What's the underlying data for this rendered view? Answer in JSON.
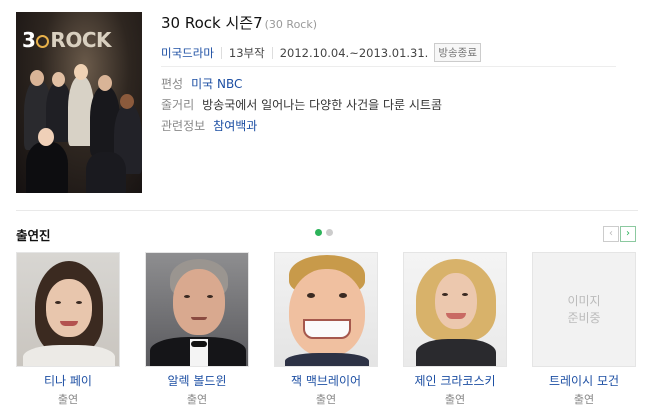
{
  "show": {
    "title": "30 Rock 시즌7",
    "original_title": "(30 Rock)",
    "poster_logo": "30ROCK",
    "genre": "미국드라마",
    "episodes": "13부작",
    "airdates": "2012.10.04.~2013.01.31.",
    "status_badge": "방송종료"
  },
  "info": [
    {
      "label": "편성",
      "value": "미국 NBC",
      "is_link": true
    },
    {
      "label": "줄거리",
      "value": "방송국에서 일어나는 다양한 사건을 다룬 시트콤",
      "is_link": false
    },
    {
      "label": "관련정보",
      "value": "참여백과",
      "is_link": true
    }
  ],
  "cast_section": {
    "title": "출연진",
    "page_count": 2,
    "current_page": 1,
    "prev_icon": "chevron-left-icon",
    "next_icon": "chevron-right-icon",
    "prev_glyph": "‹",
    "next_glyph": "›",
    "members": [
      {
        "name": "티나 페이",
        "role": "출연",
        "has_photo": true
      },
      {
        "name": "알렉 볼드윈",
        "role": "출연",
        "has_photo": true
      },
      {
        "name": "잭 맥브레이어",
        "role": "출연",
        "has_photo": true
      },
      {
        "name": "제인 크라코스키",
        "role": "출연",
        "has_photo": true
      },
      {
        "name": "트레이시 모건",
        "role": "출연",
        "has_photo": false,
        "placeholder": "이미지\n준비중"
      }
    ]
  },
  "colors": {
    "link": "#1d4fa3",
    "accent_green": "#2cb35a",
    "muted": "#888888"
  }
}
